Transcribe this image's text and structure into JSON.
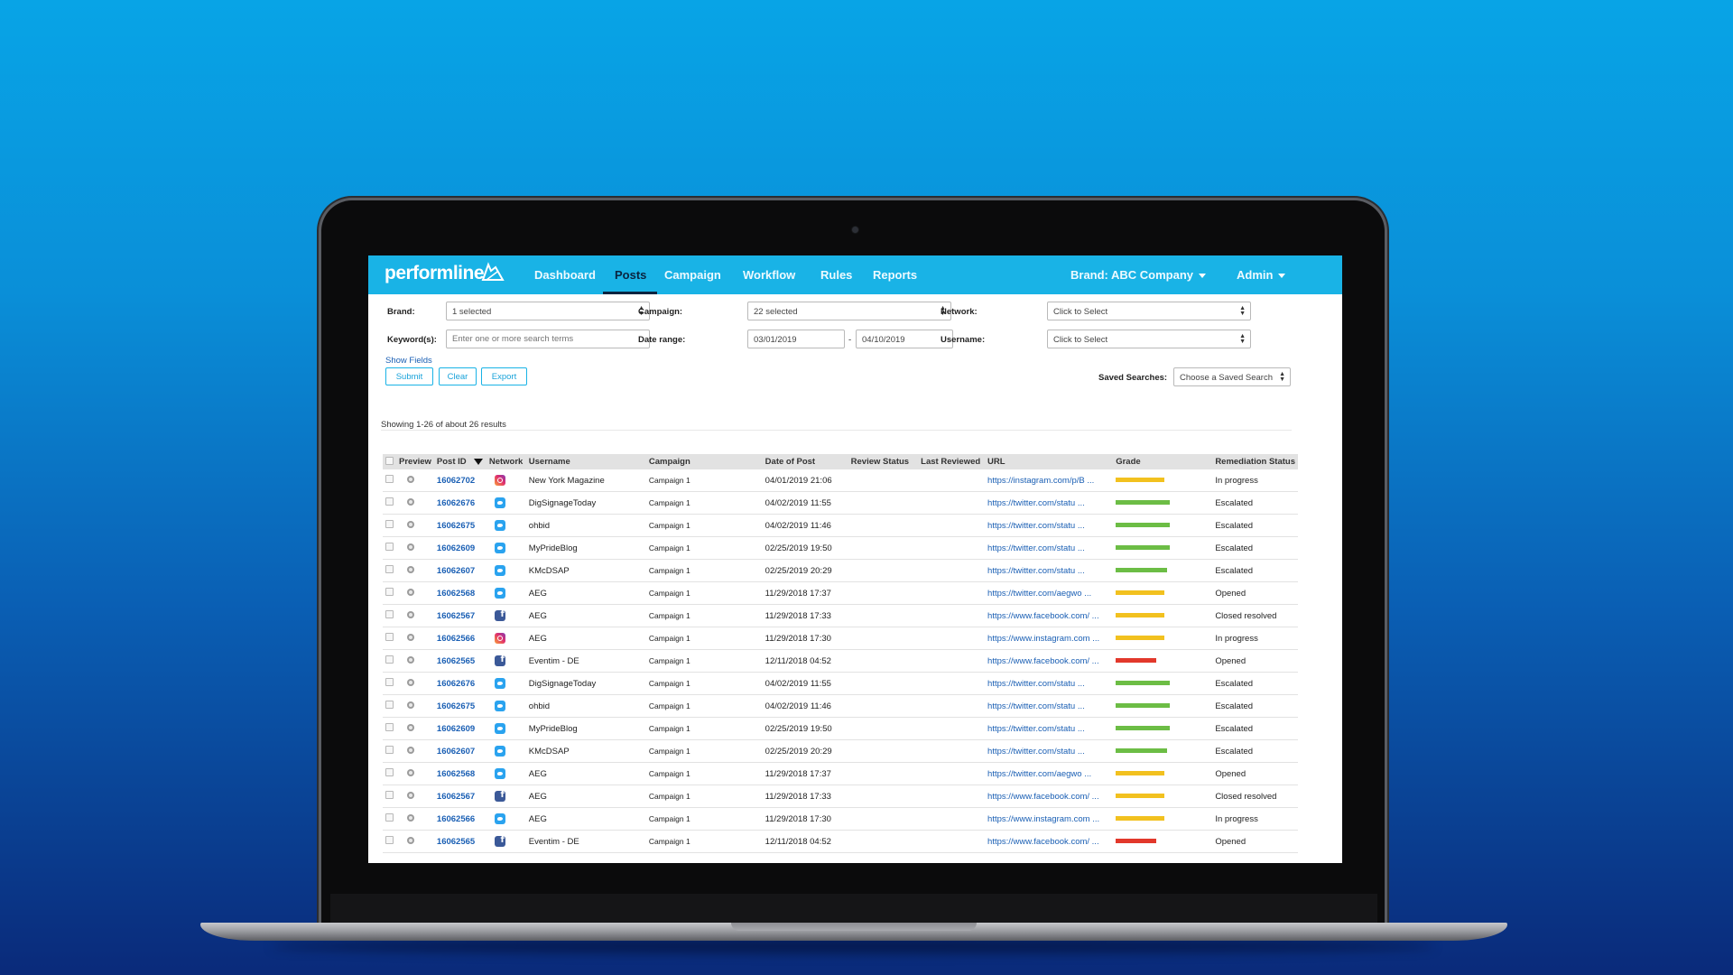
{
  "app": {
    "logo": "performline",
    "nav": [
      "Dashboard",
      "Posts",
      "Campaign",
      "Workflow",
      "Rules",
      "Reports"
    ],
    "active_nav": "Posts",
    "brand_menu": "Brand: ABC Company",
    "user_menu": "Admin"
  },
  "filters": {
    "brand_label": "Brand:",
    "brand_value": "1 selected",
    "keywords_label": "Keyword(s):",
    "keywords_placeholder": "Enter one or more search terms",
    "show_fields": "Show Fields",
    "campaign_label": "Campaign:",
    "campaign_value": "22 selected",
    "date_range_label": "Date range:",
    "date_from": "03/01/2019",
    "date_sep": "-",
    "date_to": "04/10/2019",
    "network_label": "Network:",
    "network_value": "Click to Select",
    "username_label": "Username:",
    "username_value": "Click to Select",
    "submit": "Submit",
    "clear": "Clear",
    "export": "Export",
    "saved_searches_label": "Saved Searches:",
    "saved_searches_value": "Choose a Saved Search"
  },
  "results": {
    "summary": "Showing 1-26 of about 26 results",
    "columns": [
      "Preview",
      "Post ID",
      "Network",
      "Username",
      "Campaign",
      "Date of Post",
      "Review Status",
      "Last Reviewed",
      "URL",
      "Grade",
      "Remediation Status"
    ],
    "grade_colors": {
      "green": "#6cbd45",
      "yellow": "#f2c11f",
      "red": "#e2382b"
    },
    "rows": [
      {
        "post_id": "16062702",
        "network": "instagram-icon",
        "username": "New York Magazine",
        "campaign": "Campaign 1",
        "date": "04/01/2019 21:06",
        "url": "https://instagram.com/p/B ...",
        "grade": "yellow",
        "grade_level": 0.9,
        "status": "In progress"
      },
      {
        "post_id": "16062676",
        "network": "twitter-icon",
        "username": "DigSignageToday",
        "campaign": "Campaign 1",
        "date": "04/02/2019 11:55",
        "url": "https://twitter.com/statu ...",
        "grade": "green",
        "grade_level": 1.0,
        "status": "Escalated"
      },
      {
        "post_id": "16062675",
        "network": "twitter-icon",
        "username": "ohbid",
        "campaign": "Campaign 1",
        "date": "04/02/2019 11:46",
        "url": "https://twitter.com/statu ...",
        "grade": "green",
        "grade_level": 1.0,
        "status": "Escalated"
      },
      {
        "post_id": "16062609",
        "network": "twitter-icon",
        "username": "MyPrideBlog",
        "campaign": "Campaign 1",
        "date": "02/25/2019 19:50",
        "url": "https://twitter.com/statu ...",
        "grade": "green",
        "grade_level": 1.0,
        "status": "Escalated"
      },
      {
        "post_id": "16062607",
        "network": "twitter-icon",
        "username": "KMcDSAP",
        "campaign": "Campaign 1",
        "date": "02/25/2019 20:29",
        "url": "https://twitter.com/statu ...",
        "grade": "green",
        "grade_level": 0.95,
        "status": "Escalated"
      },
      {
        "post_id": "16062568",
        "network": "twitter-icon",
        "username": "AEG",
        "campaign": "Campaign 1",
        "date": "11/29/2018 17:37",
        "url": "https://twitter.com/aegwo ...",
        "grade": "yellow",
        "grade_level": 0.9,
        "status": "Opened"
      },
      {
        "post_id": "16062567",
        "network": "facebook-icon",
        "username": "AEG",
        "campaign": "Campaign 1",
        "date": "11/29/2018 17:33",
        "url": "https://www.facebook.com/ ...",
        "grade": "yellow",
        "grade_level": 0.9,
        "status": "Closed resolved"
      },
      {
        "post_id": "16062566",
        "network": "instagram-icon",
        "username": "AEG",
        "campaign": "Campaign 1",
        "date": "11/29/2018 17:30",
        "url": "https://www.instagram.com ...",
        "grade": "yellow",
        "grade_level": 0.9,
        "status": "In progress"
      },
      {
        "post_id": "16062565",
        "network": "facebook-icon",
        "username": "Eventim - DE",
        "campaign": "Campaign 1",
        "date": "12/11/2018 04:52",
        "url": "https://www.facebook.com/ ...",
        "grade": "red",
        "grade_level": 0.75,
        "status": "Opened"
      },
      {
        "post_id": "16062676",
        "network": "twitter-icon",
        "username": "DigSignageToday",
        "campaign": "Campaign 1",
        "date": "04/02/2019 11:55",
        "url": "https://twitter.com/statu ...",
        "grade": "green",
        "grade_level": 1.0,
        "status": "Escalated"
      },
      {
        "post_id": "16062675",
        "network": "twitter-icon",
        "username": "ohbid",
        "campaign": "Campaign 1",
        "date": "04/02/2019 11:46",
        "url": "https://twitter.com/statu ...",
        "grade": "green",
        "grade_level": 1.0,
        "status": "Escalated"
      },
      {
        "post_id": "16062609",
        "network": "twitter-icon",
        "username": "MyPrideBlog",
        "campaign": "Campaign 1",
        "date": "02/25/2019 19:50",
        "url": "https://twitter.com/statu ...",
        "grade": "green",
        "grade_level": 1.0,
        "status": "Escalated"
      },
      {
        "post_id": "16062607",
        "network": "twitter-icon",
        "username": "KMcDSAP",
        "campaign": "Campaign 1",
        "date": "02/25/2019 20:29",
        "url": "https://twitter.com/statu ...",
        "grade": "green",
        "grade_level": 0.95,
        "status": "Escalated"
      },
      {
        "post_id": "16062568",
        "network": "twitter-icon",
        "username": "AEG",
        "campaign": "Campaign 1",
        "date": "11/29/2018 17:37",
        "url": "https://twitter.com/aegwo ...",
        "grade": "yellow",
        "grade_level": 0.9,
        "status": "Opened"
      },
      {
        "post_id": "16062567",
        "network": "facebook-icon",
        "username": "AEG",
        "campaign": "Campaign 1",
        "date": "11/29/2018 17:33",
        "url": "https://www.facebook.com/ ...",
        "grade": "yellow",
        "grade_level": 0.9,
        "status": "Closed resolved"
      },
      {
        "post_id": "16062566",
        "network": "twitter-icon",
        "username": "AEG",
        "campaign": "Campaign 1",
        "date": "11/29/2018 17:30",
        "url": "https://www.instagram.com ...",
        "grade": "yellow",
        "grade_level": 0.9,
        "status": "In progress"
      },
      {
        "post_id": "16062565",
        "network": "facebook-icon",
        "username": "Eventim - DE",
        "campaign": "Campaign 1",
        "date": "12/11/2018 04:52",
        "url": "https://www.facebook.com/ ...",
        "grade": "red",
        "grade_level": 0.75,
        "status": "Opened"
      }
    ]
  }
}
